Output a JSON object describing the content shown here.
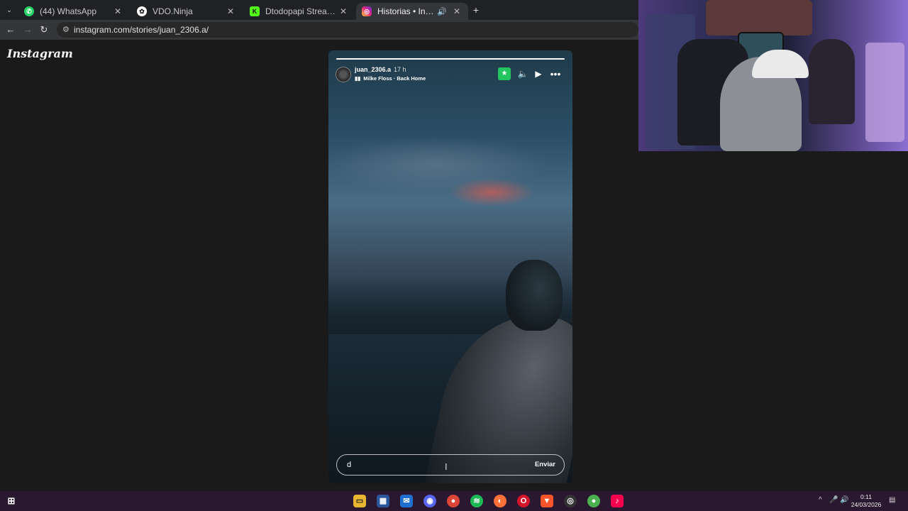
{
  "browser": {
    "tabs": [
      {
        "label": "(44) WhatsApp",
        "icon": "whatsapp-icon",
        "color": "#25d366",
        "active": false
      },
      {
        "label": "VDO.Ninja",
        "icon": "vdo-ninja-icon",
        "color": "#ffffff",
        "active": false
      },
      {
        "label": "Dtodopapi Stream - Watch Live",
        "icon": "kick-icon",
        "color": "#53fc18",
        "active": false
      },
      {
        "label": "Historias • Instagram",
        "icon": "instagram-icon",
        "color": "#e1306c",
        "active": true
      }
    ],
    "address": "instagram.com/stories/juan_2306.a/"
  },
  "page": {
    "logo": "Instagram"
  },
  "story": {
    "username": "juan_2306.a",
    "time_ago": "17 h",
    "music": "Milke Floss · Back Home",
    "progress": 1.0,
    "reply_value": "d",
    "send_label": "Enviar"
  },
  "taskbar": {
    "time": "0:11",
    "date": "24/03/2026"
  },
  "colors": {
    "accent_green": "#23c55e",
    "taskbar_bg": "#2a1730"
  }
}
